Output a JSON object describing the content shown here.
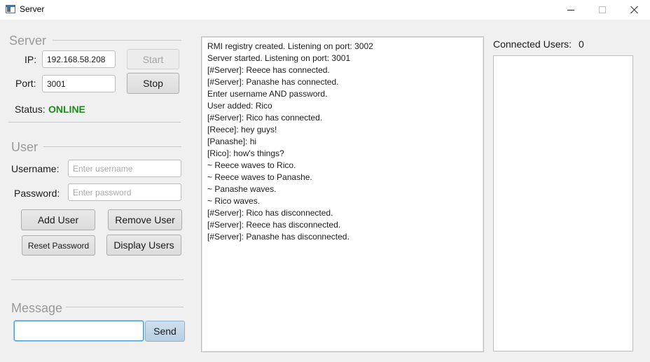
{
  "window": {
    "title": "Server",
    "controls": {
      "minimize": "minimize-icon",
      "maximize": "maximize-icon",
      "close": "close-icon"
    }
  },
  "server": {
    "heading": "Server",
    "ip_label": "IP:",
    "ip_value": "192.168.58.208",
    "port_label": "Port:",
    "port_value": "3001",
    "start_label": "Start",
    "stop_label": "Stop",
    "status_label": "Status:",
    "status_value": "ONLINE",
    "status_color": "#1e8a1e"
  },
  "user": {
    "heading": "User",
    "username_label": "Username:",
    "username_placeholder": "Enter username",
    "password_label": "Password:",
    "password_placeholder": "Enter password",
    "add_user_label": "Add User",
    "remove_user_label": "Remove User",
    "reset_password_label": "Reset Password",
    "display_users_label": "Display Users"
  },
  "message": {
    "heading": "Message",
    "input_value": "",
    "send_label": "Send"
  },
  "log": {
    "lines": [
      "RMI registry created. Listening on port: 3002",
      "Server started. Listening on port: 3001",
      "[#Server]: Reece has connected.",
      "[#Server]: Panashe has connected.",
      "Enter username AND password.",
      "User added: Rico",
      "[#Server]: Rico has connected.",
      "[Reece]: hey guys!",
      "[Panashe]: hi",
      "[Rico]: how's things?",
      "~ Reece waves to Rico.",
      "~ Reece waves to Panashe.",
      "~ Panashe waves.",
      "~ Rico waves.",
      "[#Server]: Rico has disconnected.",
      "[#Server]: Reece has disconnected.",
      "[#Server]: Panashe has disconnected."
    ]
  },
  "connected_users": {
    "label": "Connected Users:",
    "count": "0",
    "items": []
  }
}
